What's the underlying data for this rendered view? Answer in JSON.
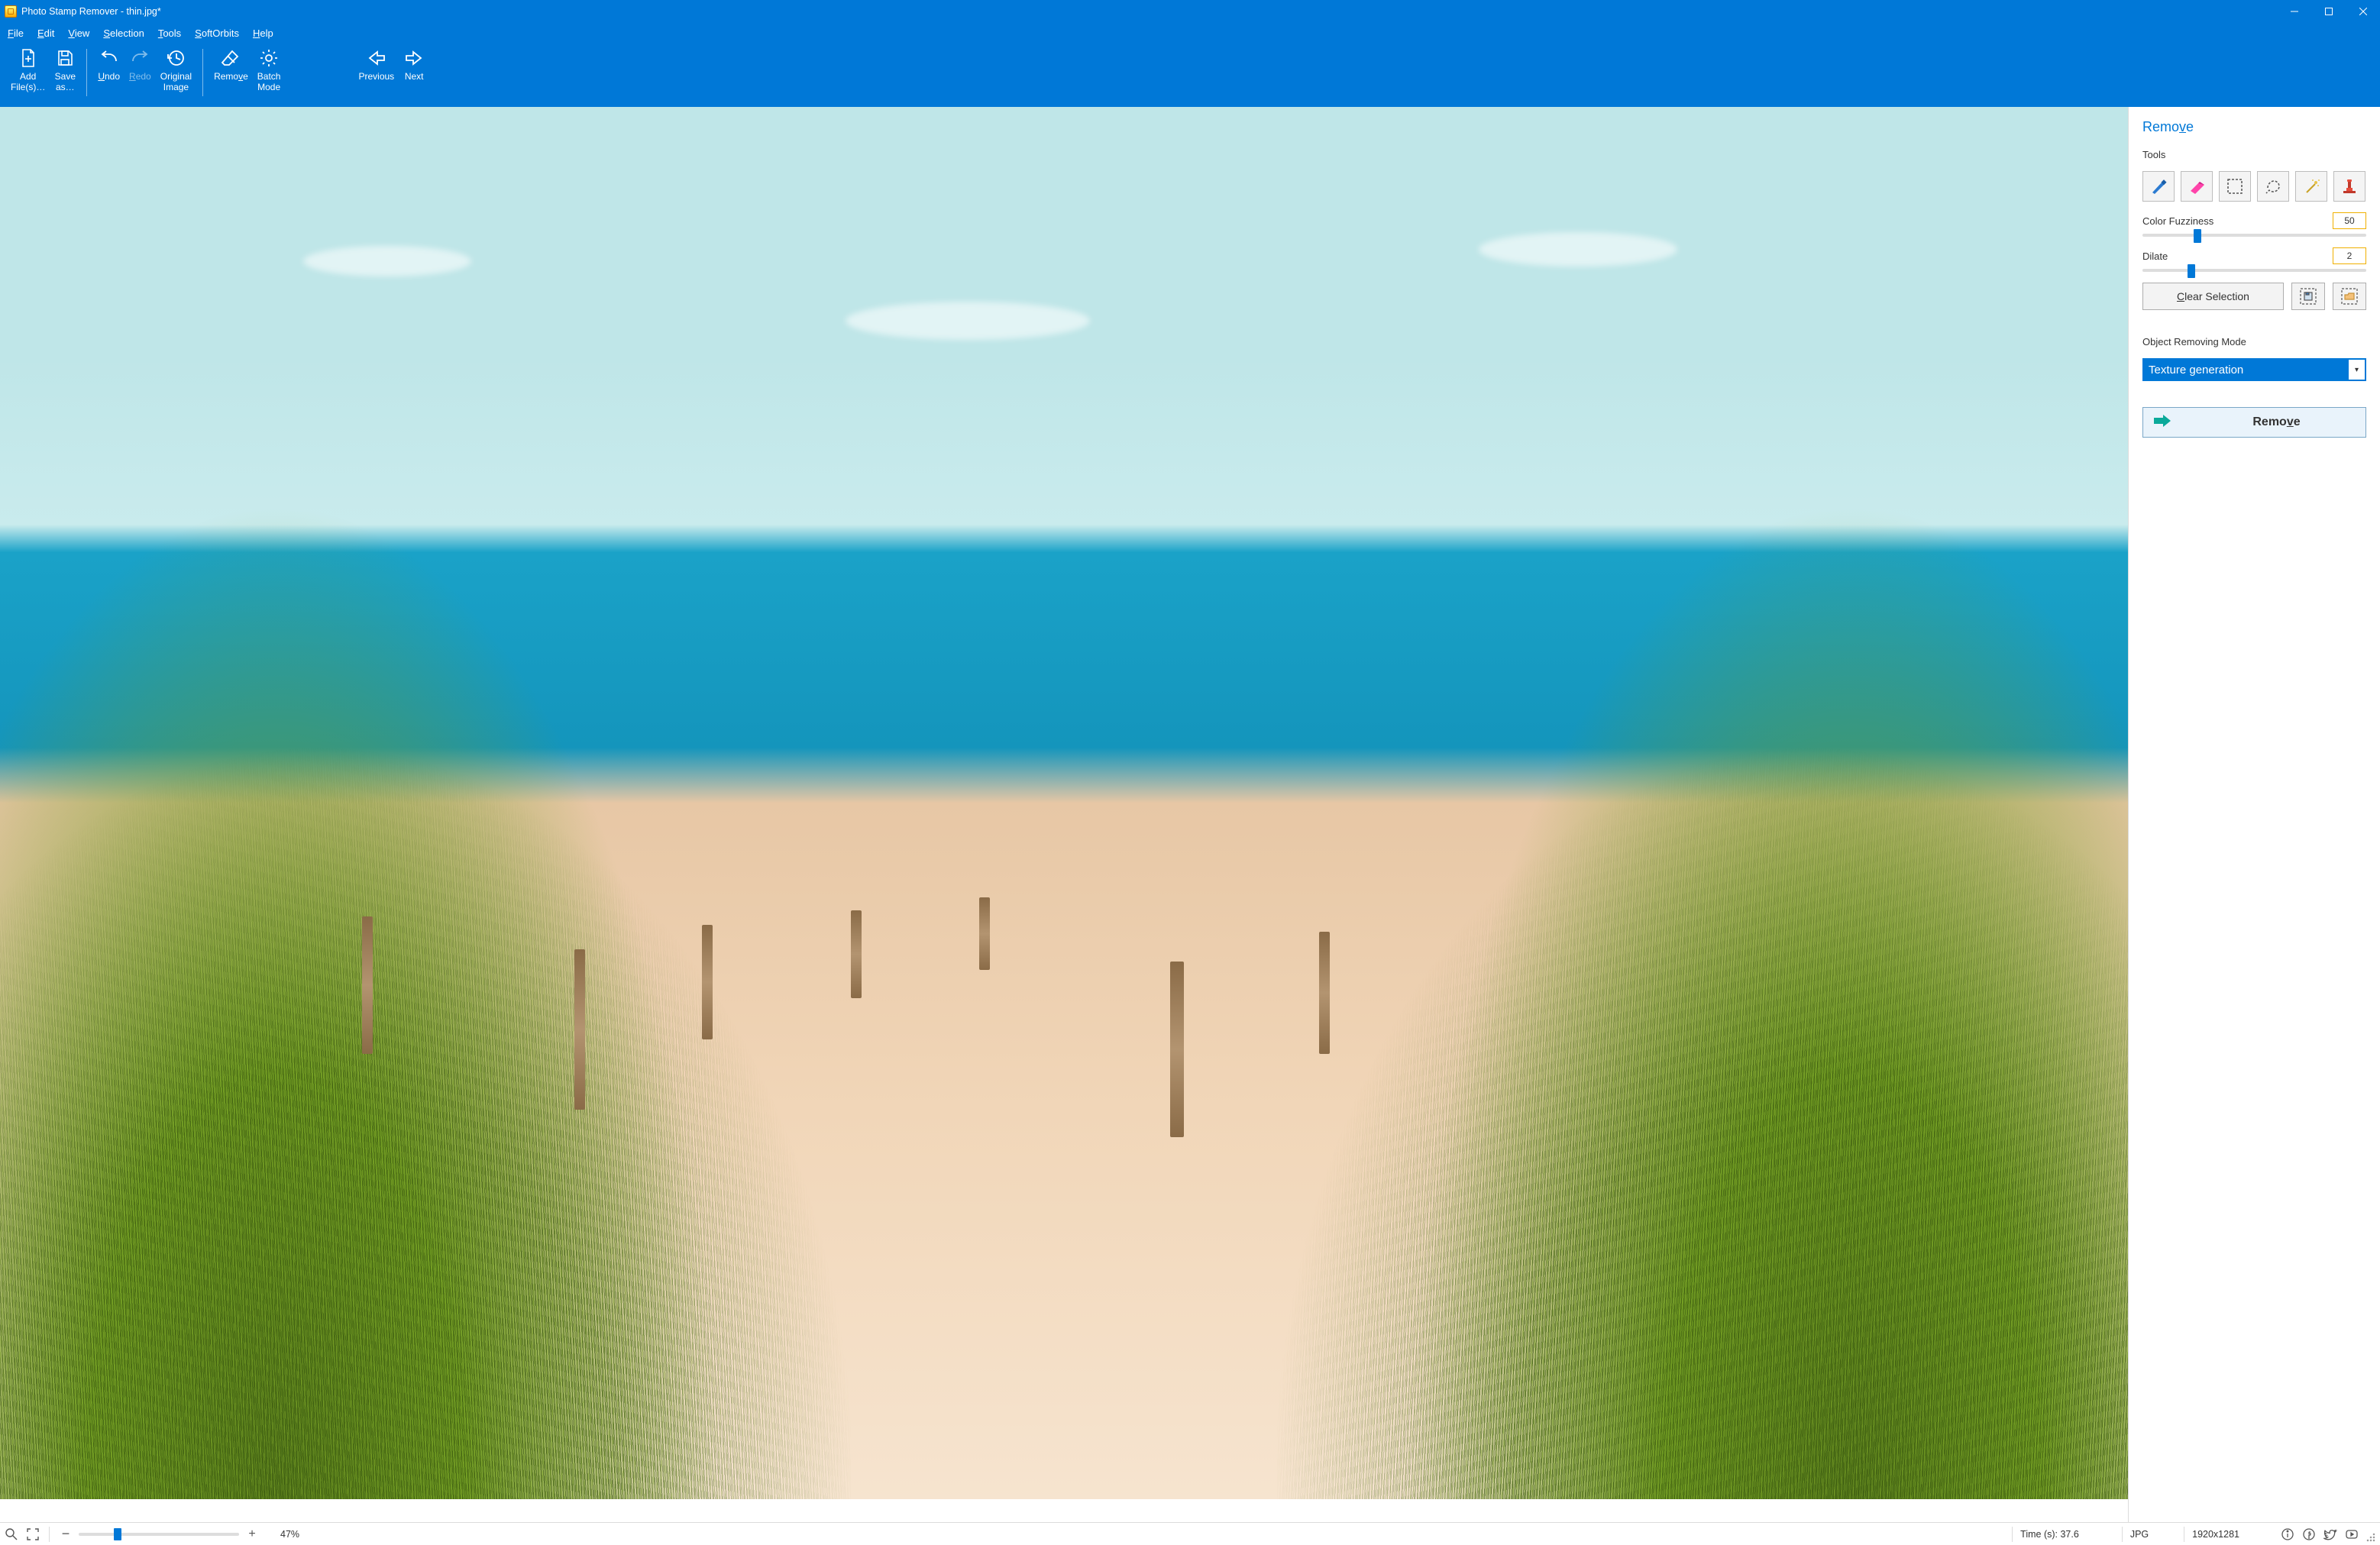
{
  "title": "Photo Stamp Remover - thin.jpg*",
  "menu": {
    "file": {
      "pre": "",
      "ul": "F",
      "post": "ile"
    },
    "edit": {
      "pre": "",
      "ul": "E",
      "post": "dit"
    },
    "view": {
      "pre": "",
      "ul": "V",
      "post": "iew"
    },
    "select": {
      "pre": "",
      "ul": "S",
      "post": "election"
    },
    "tools": {
      "pre": "",
      "ul": "T",
      "post": "ools"
    },
    "soft": {
      "pre": "",
      "ul": "S",
      "post": "oftOrbits"
    },
    "help": {
      "pre": "",
      "ul": "H",
      "post": "elp"
    }
  },
  "ribbon": {
    "addfiles": {
      "l1": "Add",
      "l2": "File(s)…"
    },
    "saveas": {
      "l1": "Save",
      "l2": "as…"
    },
    "undo": {
      "pre": "",
      "ul": "U",
      "post": "ndo"
    },
    "redo": {
      "pre": "",
      "ul": "R",
      "post": "edo"
    },
    "original": {
      "l1": "Original",
      "l2": "Image"
    },
    "remove": {
      "pre": "Remo",
      "ul": "v",
      "post": "e"
    },
    "batch": {
      "l1": "Batch",
      "l2": "Mode"
    },
    "previous": "Previous",
    "next": "Next"
  },
  "panel": {
    "heading": {
      "pre": "Remo",
      "ul": "v",
      "post": "e"
    },
    "tools_label": "Tools",
    "color_fuzziness_label": "Color Fuzziness",
    "color_fuzziness_value": "50",
    "color_fuzziness_pct": 23,
    "dilate_label": "Dilate",
    "dilate_value": "2",
    "dilate_pct": 20,
    "clear_selection": {
      "pre": "",
      "ul": "C",
      "post": "lear Selection"
    },
    "object_removing_mode_label": "Object Removing Mode",
    "object_removing_mode_value": "Texture generation",
    "remove_button": {
      "pre": "Remo",
      "ul": "v",
      "post": "e"
    },
    "tool_icons": [
      "marker-icon",
      "eraser-icon",
      "rect-select-icon",
      "lasso-icon",
      "magic-wand-icon",
      "clone-stamp-icon"
    ]
  },
  "status": {
    "zoom_pct_label": "47%",
    "zoom_slider_pct": 22,
    "time_label": "Time (s): 37.6",
    "format": "JPG",
    "dimensions": "1920x1281"
  }
}
